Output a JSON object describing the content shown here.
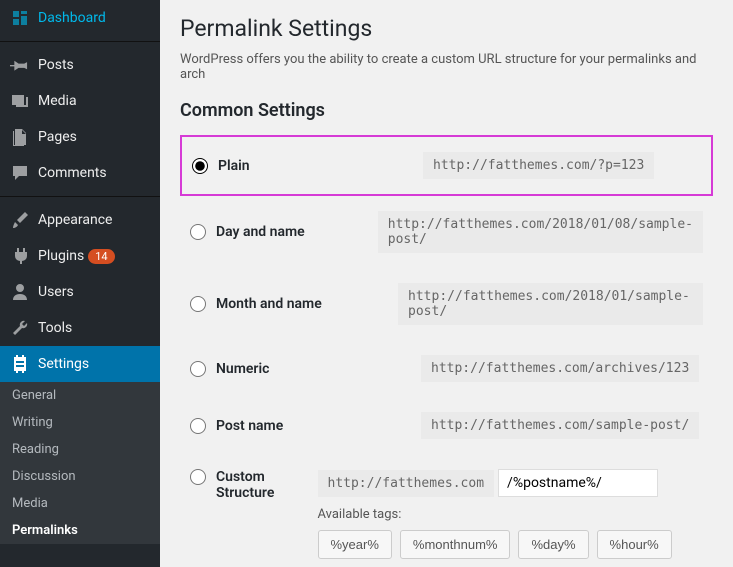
{
  "sidebar": {
    "items": [
      {
        "label": "Dashboard",
        "icon": "dashboard"
      },
      {
        "label": "Posts",
        "icon": "pin"
      },
      {
        "label": "Media",
        "icon": "media"
      },
      {
        "label": "Pages",
        "icon": "pages"
      },
      {
        "label": "Comments",
        "icon": "comment"
      },
      {
        "label": "Appearance",
        "icon": "brush"
      },
      {
        "label": "Plugins",
        "icon": "plug",
        "badge": "14"
      },
      {
        "label": "Users",
        "icon": "user"
      },
      {
        "label": "Tools",
        "icon": "wrench"
      },
      {
        "label": "Settings",
        "icon": "settings",
        "active": true
      }
    ],
    "submenu": [
      "General",
      "Writing",
      "Reading",
      "Discussion",
      "Media",
      "Permalinks"
    ],
    "submenu_current": "Permalinks"
  },
  "page": {
    "title": "Permalink Settings",
    "description": "WordPress offers you the ability to create a custom URL structure for your permalinks and arch",
    "section_title": "Common Settings",
    "options": [
      {
        "label": "Plain",
        "example": "http://fatthemes.com/?p=123",
        "checked": true,
        "highlight": true
      },
      {
        "label": "Day and name",
        "example": "http://fatthemes.com/2018/01/08/sample-post/"
      },
      {
        "label": "Month and name",
        "example": "http://fatthemes.com/2018/01/sample-post/"
      },
      {
        "label": "Numeric",
        "example": "http://fatthemes.com/archives/123"
      },
      {
        "label": "Post name",
        "example": "http://fatthemes.com/sample-post/"
      }
    ],
    "custom": {
      "label": "Custom Structure",
      "prefix": "http://fatthemes.com",
      "value": "/%postname%/",
      "tags_label": "Available tags:",
      "tags": [
        "%year%",
        "%monthnum%",
        "%day%",
        "%hour%"
      ]
    }
  }
}
